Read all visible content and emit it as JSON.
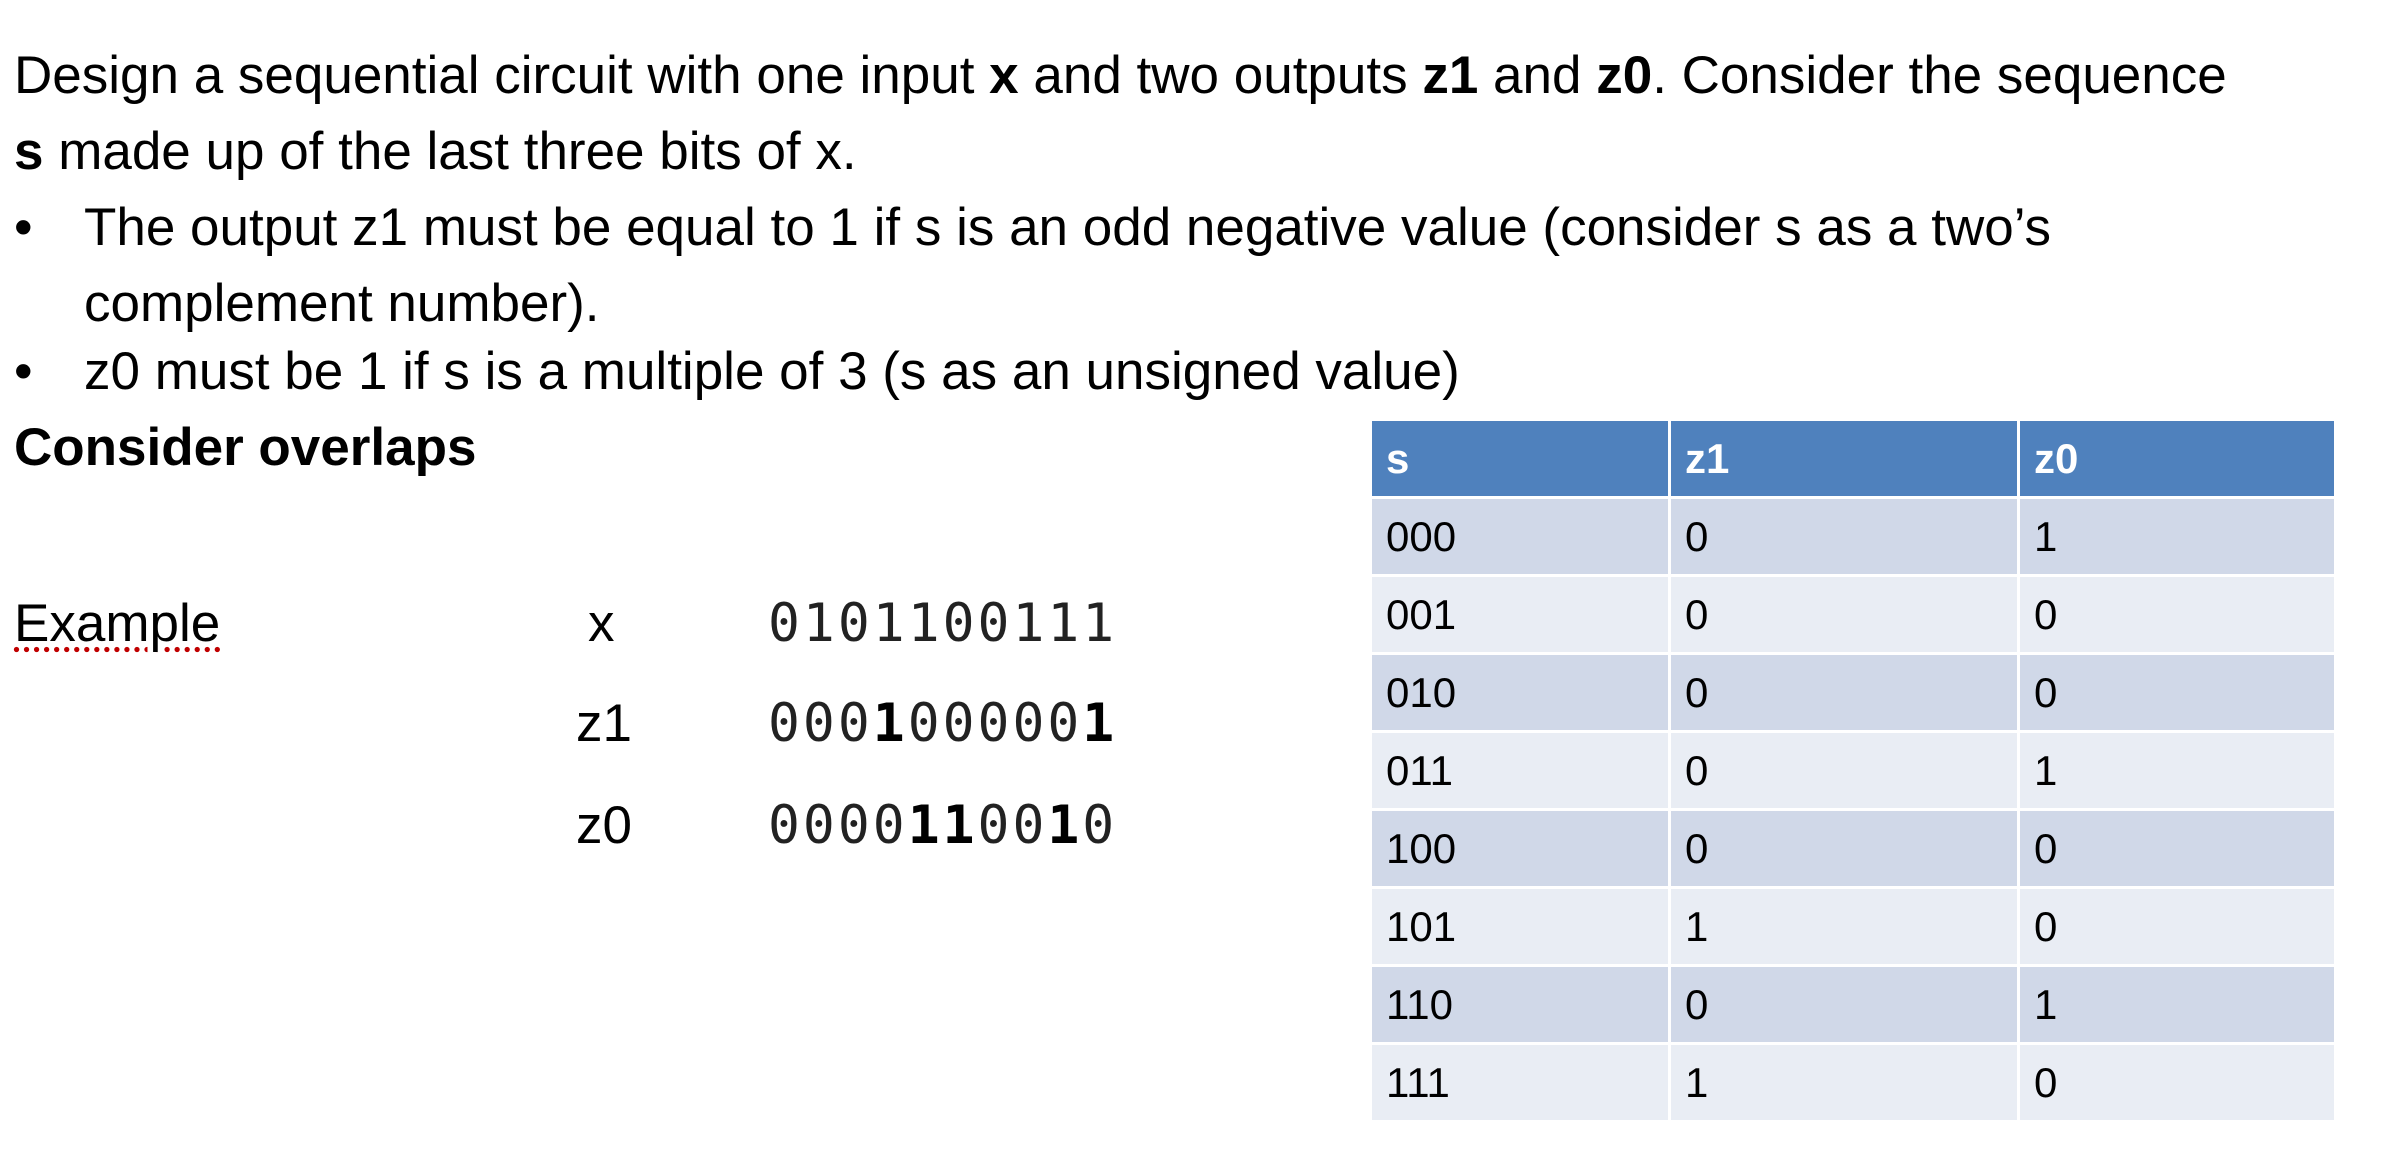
{
  "intro": {
    "t1": "Design a sequential circuit with one input ",
    "x": "x",
    "t2": " and two outputs ",
    "z1": "z1",
    "t3": " and ",
    "z0": "z0",
    "t4": ". Consider the sequence",
    "s": "s",
    "t5": " made up of the last three bits of x."
  },
  "bullets": [
    {
      "symbol": "•",
      "line1": "The output z1 must be equal to 1 if s is an odd negative value (consider s as a two’s",
      "line2": "complement number)."
    },
    {
      "symbol": "•",
      "line1": "z0 must be 1 if s is a multiple of 3 (s as an unsigned value)"
    }
  ],
  "overlaps": "Consider overlaps",
  "example": {
    "label": "Example",
    "rows": [
      {
        "label": "x",
        "bits": [
          "0",
          "1",
          "0",
          "1",
          "1",
          "0",
          "0",
          "1",
          "1",
          "1"
        ],
        "bold": []
      },
      {
        "label": "z1",
        "bits": [
          "0",
          "0",
          "0",
          "1",
          "0",
          "0",
          "0",
          "0",
          "0",
          "1"
        ],
        "bold": [
          3,
          9
        ]
      },
      {
        "label": "z0",
        "bits": [
          "0",
          "0",
          "0",
          "0",
          "1",
          "1",
          "0",
          "0",
          "1",
          "0"
        ],
        "bold": [
          4,
          5,
          8
        ]
      }
    ]
  },
  "table": {
    "headers": [
      "s",
      "z1",
      "z0"
    ],
    "rows": [
      [
        "000",
        "0",
        "1"
      ],
      [
        "001",
        "0",
        "0"
      ],
      [
        "010",
        "0",
        "0"
      ],
      [
        "011",
        "0",
        "1"
      ],
      [
        "100",
        "0",
        "0"
      ],
      [
        "101",
        "1",
        "0"
      ],
      [
        "110",
        "0",
        "1"
      ],
      [
        "111",
        "1",
        "0"
      ]
    ]
  },
  "colors": {
    "header_bg": "#4f81bd",
    "row_dark": "#d0d8e8",
    "row_light": "#e9edf4"
  }
}
